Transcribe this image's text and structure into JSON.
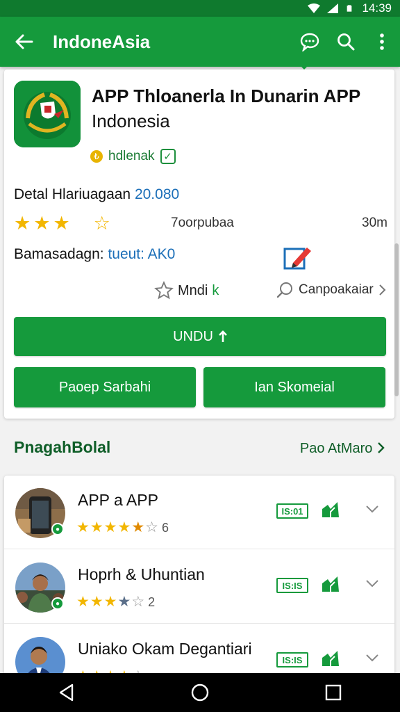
{
  "status_bar": {
    "time": "14:39"
  },
  "app_bar": {
    "title": "IndoneAsia"
  },
  "app": {
    "name_line1": "APP Thloanerla In Dunarin APP",
    "name_line2": "Indonesia",
    "developer": "hdlenak",
    "detail_label": "Detal Hlariuagaan",
    "detail_value": "20.080",
    "rating_stars": 3.5,
    "rating_mid": "7oorpubaa",
    "rating_right": "30m",
    "bama_label": "Bamasadagn:",
    "bama_value": "tueut: AK0",
    "wishlist_label": "Mndi",
    "wishlist_k": "k",
    "compare_label": "Canpoakaiar"
  },
  "buttons": {
    "install": "UNDU",
    "left": "Paoep Sarbahi",
    "right": "Ian Skomeial"
  },
  "section": {
    "title": "PnagahBolal",
    "link": "Pao AtMaro"
  },
  "list_items": [
    {
      "title": "APP a APP",
      "rating": 4.5,
      "count": "6",
      "tag": "IS:01"
    },
    {
      "title": "Hoprh & Uhuntian",
      "rating": 3.5,
      "count": "2",
      "tag": "IS:IS"
    },
    {
      "title": "Uniako Okam Degantiari",
      "rating": 4,
      "count": "",
      "tag": "IS:IS"
    }
  ],
  "colors": {
    "primary": "#159a3c",
    "status": "#0f7a2e",
    "star": "#f2b600",
    "link": "#1c6fb8"
  }
}
